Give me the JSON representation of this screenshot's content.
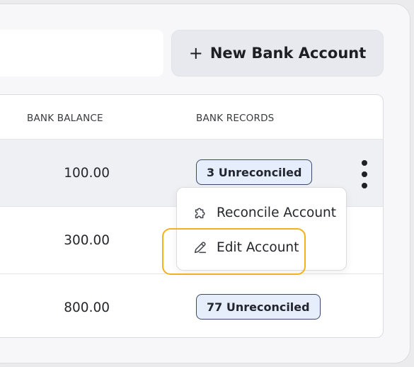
{
  "toolbar": {
    "new_account_label": "New Bank Account",
    "plus_symbol": "+"
  },
  "table": {
    "headers": {
      "bank_balance": "BANK BALANCE",
      "bank_records": "BANK RECORDS"
    },
    "rows": [
      {
        "bank_balance": "100.00",
        "bank_records": "3 Unreconciled"
      },
      {
        "bank_balance": "300.00",
        "bank_records": ""
      },
      {
        "bank_balance": "800.00",
        "bank_records": "77 Unreconciled"
      }
    ]
  },
  "row_menu": {
    "items": [
      {
        "label": "Reconcile Account",
        "icon": "puzzle-icon"
      },
      {
        "label": "Edit Account",
        "icon": "pencil-icon"
      }
    ]
  },
  "colors": {
    "badge_bg": "#e6edfb",
    "badge_border": "#3b4a6b",
    "focus_ring": "#f1b21c",
    "row_highlight": "#eef0f4"
  }
}
